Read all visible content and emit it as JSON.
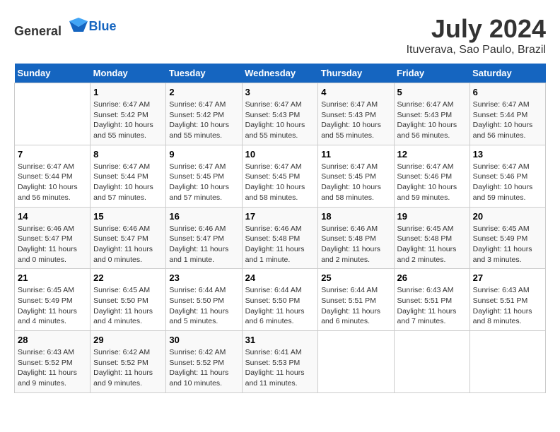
{
  "header": {
    "logo_general": "General",
    "logo_blue": "Blue",
    "title": "July 2024",
    "subtitle": "Ituverava, Sao Paulo, Brazil"
  },
  "calendar": {
    "days_of_week": [
      "Sunday",
      "Monday",
      "Tuesday",
      "Wednesday",
      "Thursday",
      "Friday",
      "Saturday"
    ],
    "weeks": [
      [
        {
          "day": "",
          "info": ""
        },
        {
          "day": "1",
          "info": "Sunrise: 6:47 AM\nSunset: 5:42 PM\nDaylight: 10 hours\nand 55 minutes."
        },
        {
          "day": "2",
          "info": "Sunrise: 6:47 AM\nSunset: 5:42 PM\nDaylight: 10 hours\nand 55 minutes."
        },
        {
          "day": "3",
          "info": "Sunrise: 6:47 AM\nSunset: 5:43 PM\nDaylight: 10 hours\nand 55 minutes."
        },
        {
          "day": "4",
          "info": "Sunrise: 6:47 AM\nSunset: 5:43 PM\nDaylight: 10 hours\nand 55 minutes."
        },
        {
          "day": "5",
          "info": "Sunrise: 6:47 AM\nSunset: 5:43 PM\nDaylight: 10 hours\nand 56 minutes."
        },
        {
          "day": "6",
          "info": "Sunrise: 6:47 AM\nSunset: 5:44 PM\nDaylight: 10 hours\nand 56 minutes."
        }
      ],
      [
        {
          "day": "7",
          "info": "Sunrise: 6:47 AM\nSunset: 5:44 PM\nDaylight: 10 hours\nand 56 minutes."
        },
        {
          "day": "8",
          "info": "Sunrise: 6:47 AM\nSunset: 5:44 PM\nDaylight: 10 hours\nand 57 minutes."
        },
        {
          "day": "9",
          "info": "Sunrise: 6:47 AM\nSunset: 5:45 PM\nDaylight: 10 hours\nand 57 minutes."
        },
        {
          "day": "10",
          "info": "Sunrise: 6:47 AM\nSunset: 5:45 PM\nDaylight: 10 hours\nand 58 minutes."
        },
        {
          "day": "11",
          "info": "Sunrise: 6:47 AM\nSunset: 5:45 PM\nDaylight: 10 hours\nand 58 minutes."
        },
        {
          "day": "12",
          "info": "Sunrise: 6:47 AM\nSunset: 5:46 PM\nDaylight: 10 hours\nand 59 minutes."
        },
        {
          "day": "13",
          "info": "Sunrise: 6:47 AM\nSunset: 5:46 PM\nDaylight: 10 hours\nand 59 minutes."
        }
      ],
      [
        {
          "day": "14",
          "info": "Sunrise: 6:46 AM\nSunset: 5:47 PM\nDaylight: 11 hours\nand 0 minutes."
        },
        {
          "day": "15",
          "info": "Sunrise: 6:46 AM\nSunset: 5:47 PM\nDaylight: 11 hours\nand 0 minutes."
        },
        {
          "day": "16",
          "info": "Sunrise: 6:46 AM\nSunset: 5:47 PM\nDaylight: 11 hours\nand 1 minute."
        },
        {
          "day": "17",
          "info": "Sunrise: 6:46 AM\nSunset: 5:48 PM\nDaylight: 11 hours\nand 1 minute."
        },
        {
          "day": "18",
          "info": "Sunrise: 6:46 AM\nSunset: 5:48 PM\nDaylight: 11 hours\nand 2 minutes."
        },
        {
          "day": "19",
          "info": "Sunrise: 6:45 AM\nSunset: 5:48 PM\nDaylight: 11 hours\nand 2 minutes."
        },
        {
          "day": "20",
          "info": "Sunrise: 6:45 AM\nSunset: 5:49 PM\nDaylight: 11 hours\nand 3 minutes."
        }
      ],
      [
        {
          "day": "21",
          "info": "Sunrise: 6:45 AM\nSunset: 5:49 PM\nDaylight: 11 hours\nand 4 minutes."
        },
        {
          "day": "22",
          "info": "Sunrise: 6:45 AM\nSunset: 5:50 PM\nDaylight: 11 hours\nand 4 minutes."
        },
        {
          "day": "23",
          "info": "Sunrise: 6:44 AM\nSunset: 5:50 PM\nDaylight: 11 hours\nand 5 minutes."
        },
        {
          "day": "24",
          "info": "Sunrise: 6:44 AM\nSunset: 5:50 PM\nDaylight: 11 hours\nand 6 minutes."
        },
        {
          "day": "25",
          "info": "Sunrise: 6:44 AM\nSunset: 5:51 PM\nDaylight: 11 hours\nand 6 minutes."
        },
        {
          "day": "26",
          "info": "Sunrise: 6:43 AM\nSunset: 5:51 PM\nDaylight: 11 hours\nand 7 minutes."
        },
        {
          "day": "27",
          "info": "Sunrise: 6:43 AM\nSunset: 5:51 PM\nDaylight: 11 hours\nand 8 minutes."
        }
      ],
      [
        {
          "day": "28",
          "info": "Sunrise: 6:43 AM\nSunset: 5:52 PM\nDaylight: 11 hours\nand 9 minutes."
        },
        {
          "day": "29",
          "info": "Sunrise: 6:42 AM\nSunset: 5:52 PM\nDaylight: 11 hours\nand 9 minutes."
        },
        {
          "day": "30",
          "info": "Sunrise: 6:42 AM\nSunset: 5:52 PM\nDaylight: 11 hours\nand 10 minutes."
        },
        {
          "day": "31",
          "info": "Sunrise: 6:41 AM\nSunset: 5:53 PM\nDaylight: 11 hours\nand 11 minutes."
        },
        {
          "day": "",
          "info": ""
        },
        {
          "day": "",
          "info": ""
        },
        {
          "day": "",
          "info": ""
        }
      ]
    ]
  }
}
